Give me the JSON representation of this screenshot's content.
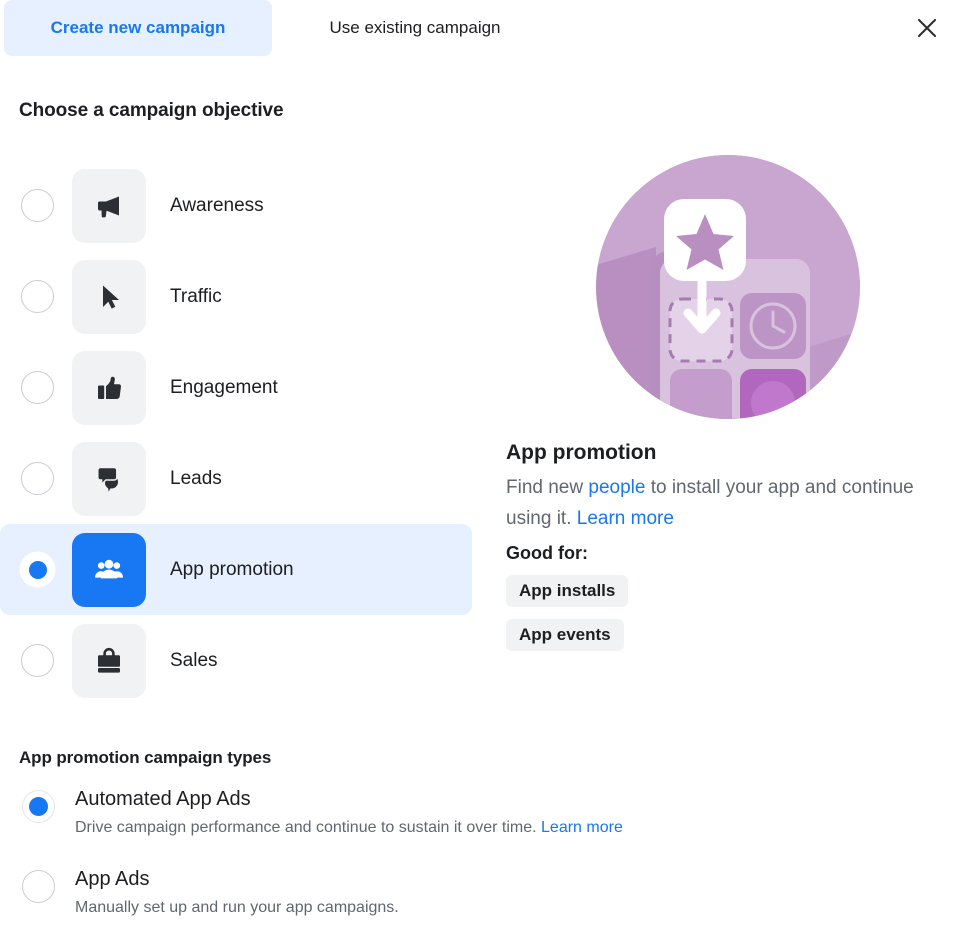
{
  "header": {
    "tabs": [
      {
        "label": "Create new campaign",
        "active": true
      },
      {
        "label": "Use existing campaign",
        "active": false
      }
    ],
    "close_icon": "close-icon"
  },
  "objective_section": {
    "title": "Choose a campaign objective",
    "items": [
      {
        "label": "Awareness",
        "icon": "megaphone-icon",
        "selected": false
      },
      {
        "label": "Traffic",
        "icon": "cursor-arrow-icon",
        "selected": false
      },
      {
        "label": "Engagement",
        "icon": "thumbs-up-icon",
        "selected": false
      },
      {
        "label": "Leads",
        "icon": "speech-bubbles-icon",
        "selected": false
      },
      {
        "label": "App promotion",
        "icon": "people-group-icon",
        "selected": true
      },
      {
        "label": "Sales",
        "icon": "shopping-bag-icon",
        "selected": false
      }
    ]
  },
  "detail_panel": {
    "illustration": "app-promotion-illustration",
    "title": "App promotion",
    "description_part1": "Find new ",
    "description_link1": "people",
    "description_part2": " to install your app and continue using it. ",
    "description_link2": "Learn more",
    "good_for_label": "Good for:",
    "badges": [
      "App installs",
      "App events"
    ]
  },
  "campaign_types": {
    "title": "App promotion campaign types",
    "options": [
      {
        "name": "Automated App Ads",
        "description": "Drive campaign performance and continue to sustain it over time. ",
        "link": "Learn more",
        "selected": true
      },
      {
        "name": "App Ads",
        "description": "Manually set up and run your app campaigns.",
        "link": "",
        "selected": false
      }
    ]
  },
  "colors": {
    "accent_blue": "#1877f2",
    "selected_row_bg": "#e7f0fe",
    "tile_gray": "#f1f2f3",
    "text_primary": "#1c1e21",
    "text_secondary": "#606770",
    "illustration_purple": "#c9a6cf"
  }
}
